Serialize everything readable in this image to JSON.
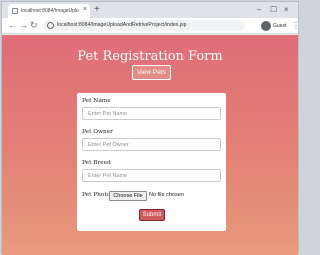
{
  "browser": {
    "tab_title": "localhost:8084/ImageUploadAndRe",
    "tab_close": "×",
    "new_tab": "+",
    "window_controls": {
      "minimize": "–",
      "maximize": "☐",
      "close": "×"
    },
    "nav": {
      "back": "←",
      "forward": "→",
      "reload": "↻"
    },
    "url": "localhost:8084/ImageUploadAndRetriveProject/index.jsp",
    "profile_label": "Guest",
    "menu": "⋮"
  },
  "page": {
    "title": "Pet Registration Form",
    "view_button": "View Pets",
    "form": {
      "pet_name": {
        "label": "Pet Name",
        "placeholder": "Enter Pet Name",
        "value": ""
      },
      "pet_owner": {
        "label": "Pet Owner",
        "placeholder": "Enter Pet Owner",
        "value": ""
      },
      "pet_breed": {
        "label": "Pet Breed",
        "placeholder": "Enter Pet Name",
        "value": ""
      },
      "pet_photo": {
        "label": "Pet Photo:",
        "button": "Choose File",
        "status": "No file chosen"
      },
      "submit": "Submit"
    }
  },
  "colors": {
    "page_gradient_top": "#df6d78",
    "page_gradient_bottom": "#e89a7e",
    "submit_button": "#d4585f",
    "heading_text": "#ffffff"
  }
}
